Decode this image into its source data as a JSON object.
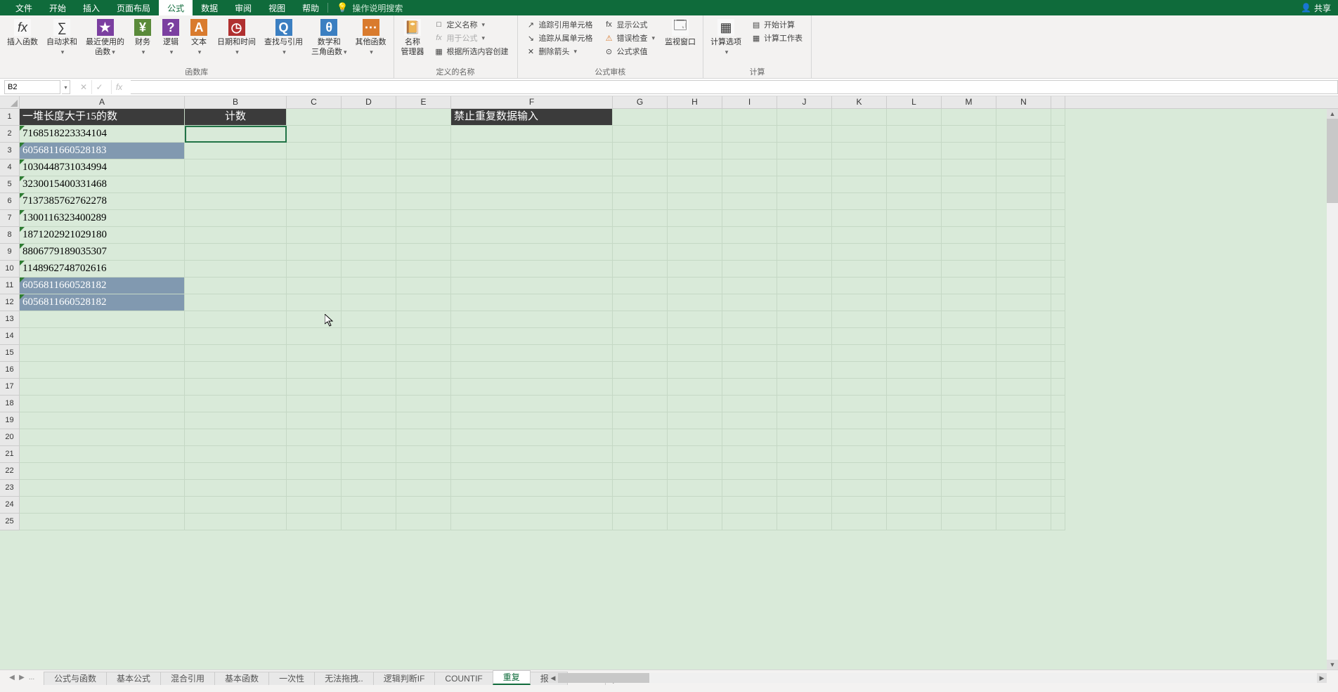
{
  "tabs": {
    "file": "文件",
    "home": "开始",
    "insert": "插入",
    "layout": "页面布局",
    "formula": "公式",
    "data": "数据",
    "review": "审阅",
    "view": "视图",
    "help": "帮助",
    "tellme": "操作说明搜索"
  },
  "share": "共享",
  "ribbon": {
    "insert_fn": "插入函数",
    "autosum": "自动求和",
    "recent": "最近使用的\n函数",
    "finance": "财务",
    "logic": "逻辑",
    "text": "文本",
    "datetime": "日期和时间",
    "lookup": "查找与引用",
    "math": "数学和\n三角函数",
    "other": "其他函数",
    "group_lib": "函数库",
    "name_mgr": "名称\n管理器",
    "define": "定义名称",
    "use_in": "用于公式",
    "from_sel": "根据所选内容创建",
    "group_names": "定义的名称",
    "trace_pre": "追踪引用单元格",
    "trace_dep": "追踪从属单元格",
    "remove_arr": "删除箭头",
    "show_fml": "显示公式",
    "err_chk": "错误检查",
    "eval": "公式求值",
    "watch": "监视窗口",
    "group_audit": "公式审核",
    "calc_opt": "计算选项",
    "calc_now": "开始计算",
    "calc_sheet": "计算工作表",
    "group_calc": "计算"
  },
  "namebox": "B2",
  "cols": [
    "A",
    "B",
    "C",
    "D",
    "E",
    "F",
    "G",
    "H",
    "I",
    "J",
    "K",
    "L",
    "M",
    "N"
  ],
  "cells": {
    "A1": "一堆长度大于15的数",
    "B1": "计数",
    "F1": "禁止重复数据输入",
    "A2": "7168518223334104",
    "A3": "6056811660528183",
    "A4": "1030448731034994",
    "A5": "3230015400331468",
    "A6": "7137385762762278",
    "A7": "1300116323400289",
    "A8": "1871202921029180",
    "A9": "8806779189035307",
    "A10": "1148962748702616",
    "A11": "6056811660528182",
    "A12": "6056811660528182"
  },
  "sheets": {
    "s1": "公式与函数",
    "s2": "基本公式",
    "s3": "混合引用",
    "s4": "基本函数",
    "s5": "一次性",
    "s6": "无法拖拽..",
    "s7": "逻辑判断IF",
    "s8": "COUNTIF",
    "s9": "重复",
    "s10": "报名"
  },
  "more": "..."
}
